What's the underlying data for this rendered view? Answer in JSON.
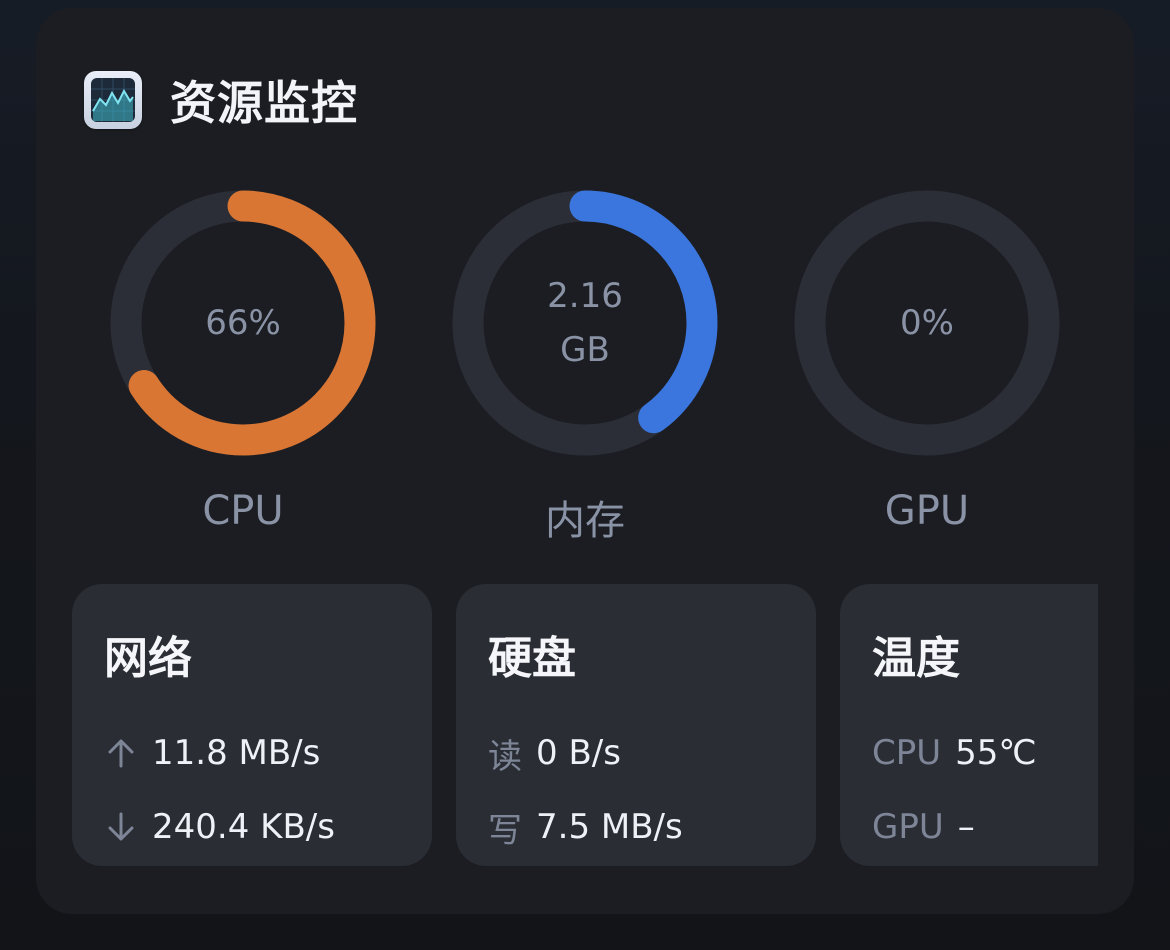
{
  "app": {
    "title": "资源监控",
    "icon": "activity-monitor-icon"
  },
  "gauges": [
    {
      "id": "cpu",
      "label": "CPU",
      "value_text": "66%",
      "sub_text": "",
      "fraction": 0.66,
      "color": "#d97634"
    },
    {
      "id": "memory",
      "label": "内存",
      "value_text": "2.16",
      "sub_text": "GB",
      "fraction": 0.4,
      "color": "#3a76de"
    },
    {
      "id": "gpu",
      "label": "GPU",
      "value_text": "0%",
      "sub_text": "",
      "fraction": 0.0,
      "color": "#3a76de"
    }
  ],
  "track_color": "#2b2e36",
  "cards": {
    "network": {
      "title": "网络",
      "upload_icon": "arrow-up-icon",
      "upload": "11.8 MB/s",
      "download_icon": "arrow-down-icon",
      "download": "240.4 KB/s"
    },
    "disk": {
      "title": "硬盘",
      "read_label": "读",
      "read": "0 B/s",
      "write_label": "写",
      "write": "7.5 MB/s"
    },
    "temperature": {
      "title": "温度",
      "cpu_label": "CPU",
      "cpu": "55℃",
      "gpu_label": "GPU",
      "gpu": "–"
    }
  }
}
